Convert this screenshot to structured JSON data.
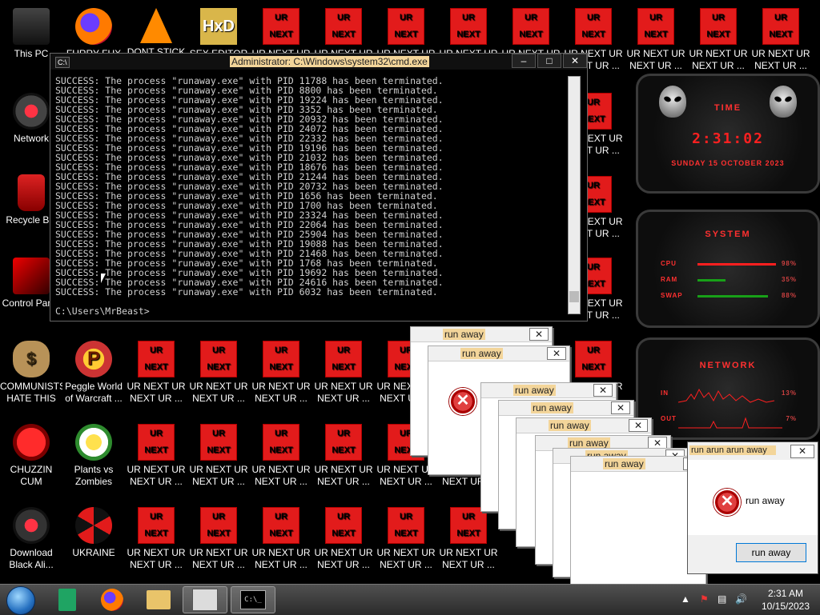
{
  "desktop_icons": [
    {
      "id": "this-pc",
      "label": "This PC",
      "kind": "pc"
    },
    {
      "id": "furry-fux",
      "label": "FURRY FUX",
      "kind": "fox"
    },
    {
      "id": "dont-stick",
      "label": "DONT STICK THIS IN YO...",
      "kind": "cone"
    },
    {
      "id": "sex-editor",
      "label": "SEX EDITOR",
      "kind": "hxd"
    },
    {
      "id": "network",
      "label": "Network",
      "kind": "net"
    },
    {
      "id": "recycle-bin",
      "label": "Recycle Bin",
      "kind": "bin"
    },
    {
      "id": "control-panel",
      "label": "Control Panel",
      "kind": "cp"
    },
    {
      "id": "communists",
      "label": "COMMUNISTS HATE THIS G...",
      "kind": "money"
    },
    {
      "id": "peggle",
      "label": "Peggle World of Warcraft ...",
      "kind": "peg"
    },
    {
      "id": "chuzzin",
      "label": "CHUZZIN CUM",
      "kind": "chuz"
    },
    {
      "id": "pvz",
      "label": "Plants vs Zombies",
      "kind": "pvz"
    },
    {
      "id": "black-ali",
      "label": "Download Black Ali...",
      "kind": "ba"
    },
    {
      "id": "ukraine",
      "label": "UKRAINE",
      "kind": "ukr"
    }
  ],
  "ur_tile": {
    "top": "UR",
    "bottom": "NEXT",
    "label": "UR NEXT UR NEXT UR ..."
  },
  "cmd": {
    "title": "Administrator: C:\\Windows\\system32\\cmd.exe",
    "icon": "C:\\",
    "lines": [
      "SUCCESS: The process \"runaway.exe\" with PID 11788 has been terminated.",
      "SUCCESS: The process \"runaway.exe\" with PID 8800 has been terminated.",
      "SUCCESS: The process \"runaway.exe\" with PID 19224 has been terminated.",
      "SUCCESS: The process \"runaway.exe\" with PID 3352 has been terminated.",
      "SUCCESS: The process \"runaway.exe\" with PID 20932 has been terminated.",
      "SUCCESS: The process \"runaway.exe\" with PID 24072 has been terminated.",
      "SUCCESS: The process \"runaway.exe\" with PID 22332 has been terminated.",
      "SUCCESS: The process \"runaway.exe\" with PID 19196 has been terminated.",
      "SUCCESS: The process \"runaway.exe\" with PID 21032 has been terminated.",
      "SUCCESS: The process \"runaway.exe\" with PID 18676 has been terminated.",
      "SUCCESS: The process \"runaway.exe\" with PID 21244 has been terminated.",
      "SUCCESS: The process \"runaway.exe\" with PID 20732 has been terminated.",
      "SUCCESS: The process \"runaway.exe\" with PID 1656 has been terminated.",
      "SUCCESS: The process \"runaway.exe\" with PID 1700 has been terminated.",
      "SUCCESS: The process \"runaway.exe\" with PID 23324 has been terminated.",
      "SUCCESS: The process \"runaway.exe\" with PID 22064 has been terminated.",
      "SUCCESS: The process \"runaway.exe\" with PID 25904 has been terminated.",
      "SUCCESS: The process \"runaway.exe\" with PID 19088 has been terminated.",
      "SUCCESS: The process \"runaway.exe\" with PID 21468 has been terminated.",
      "SUCCESS: The process \"runaway.exe\" with PID 1768 has been terminated.",
      "SUCCESS: The process \"runaway.exe\" with PID 19692 has been terminated.",
      "SUCCESS: The process \"runaway.exe\" with PID 24616 has been terminated.",
      "SUCCESS: The process \"runaway.exe\" with PID 6032 has been terminated."
    ],
    "prompt": "C:\\Users\\MrBeast>"
  },
  "widgets": {
    "time": {
      "title": "TIME",
      "time": "2:31:02",
      "date": "SUNDAY 15 OCTOBER 2023"
    },
    "system": {
      "title": "SYSTEM",
      "rows": [
        {
          "label": "CPU",
          "percent": "98%",
          "value": 0.98,
          "color": "#ff1f1f"
        },
        {
          "label": "RAM",
          "percent": "35%",
          "value": 0.35,
          "color": "#18a018"
        },
        {
          "label": "SWAP",
          "percent": "88%",
          "value": 0.88,
          "color": "#18a018"
        }
      ]
    },
    "network": {
      "title": "NETWORK",
      "rows": [
        {
          "label": "IN",
          "percent": "13%"
        },
        {
          "label": "OUT",
          "percent": "7%"
        }
      ]
    }
  },
  "msgbox": {
    "title": "run away",
    "message": "run away",
    "button": "run away",
    "front_title": "run arun arun away"
  },
  "taskbar": {
    "items": [
      "sheets",
      "firefox",
      "explorer",
      "paint",
      "cmd"
    ],
    "cmd_icon": "C:\\_",
    "clock_time": "2:31 AM",
    "clock_date": "10/15/2023"
  }
}
